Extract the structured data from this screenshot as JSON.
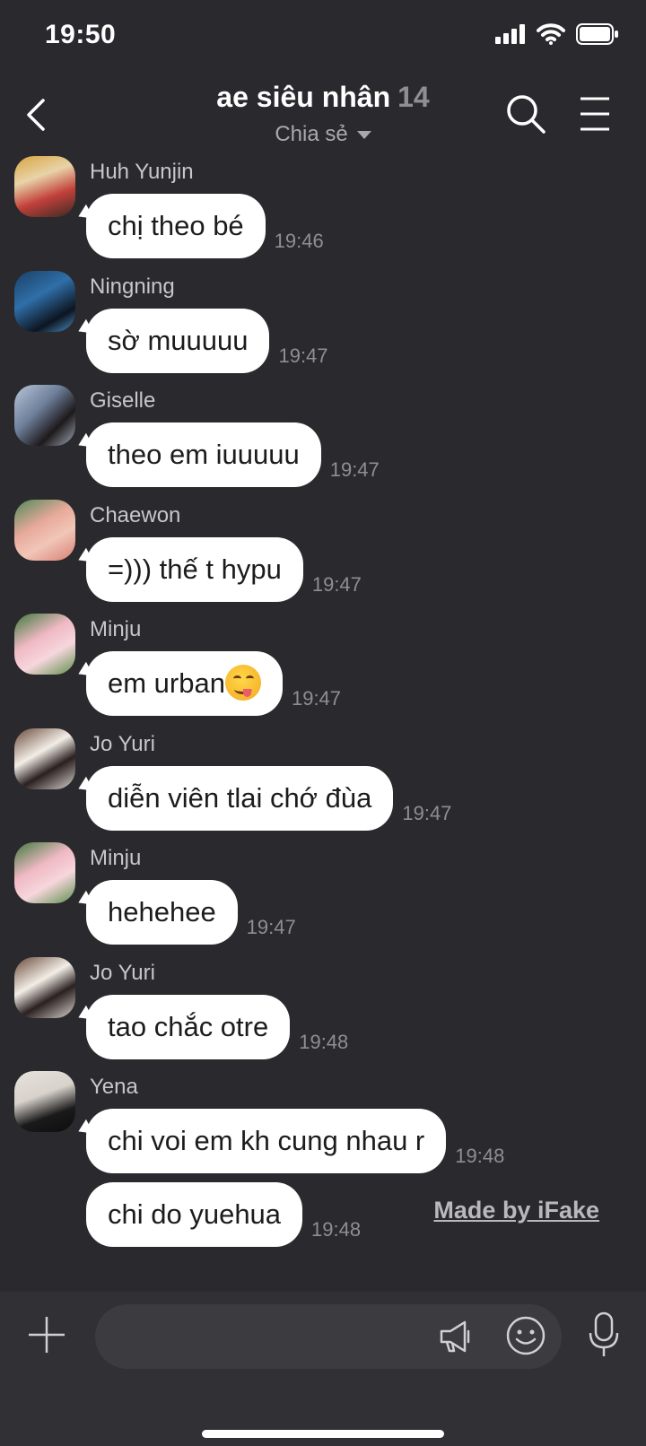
{
  "status": {
    "time": "19:50"
  },
  "header": {
    "title": "ae siêu nhân",
    "member_count": "14",
    "subtitle": "Chia sẻ"
  },
  "messages": [
    {
      "sender": "Huh Yunjin",
      "text": "chị theo bé",
      "time": "19:46"
    },
    {
      "sender": "Ningning",
      "text": "sờ muuuuu",
      "time": "19:47"
    },
    {
      "sender": "Giselle",
      "text": "theo em iuuuuu",
      "time": "19:47"
    },
    {
      "sender": "Chaewon",
      "text": "=))) thế t hypu",
      "time": "19:47"
    },
    {
      "sender": "Minju",
      "text": "em urban",
      "time": "19:47"
    },
    {
      "sender": "Jo Yuri",
      "text": "diễn viên tlai chớ đùa",
      "time": "19:47"
    },
    {
      "sender": "Minju",
      "text": "hehehee",
      "time": "19:47"
    },
    {
      "sender": "Jo Yuri",
      "text": "tao chắc otre",
      "time": "19:48"
    },
    {
      "sender": "Yena",
      "text": "chi voi em kh cung nhau r",
      "time": "19:48"
    },
    {
      "sender": "",
      "text": "chi do yuehua",
      "time": "19:48"
    }
  ],
  "watermark": "Made by iFake",
  "colors": {
    "background": "#2a2a2e",
    "bubble": "#ffffff",
    "input_bar": "#313135"
  }
}
